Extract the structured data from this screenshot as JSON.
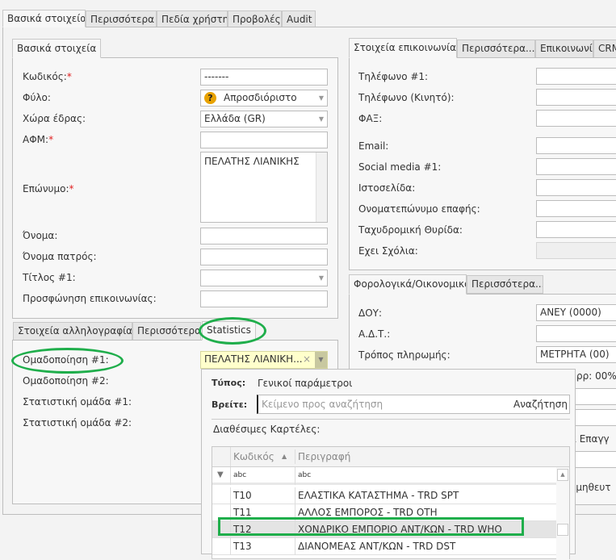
{
  "main_tabs": [
    "Βασικά στοιχεία",
    "Περισσότερα",
    "Πεδία χρήστη",
    "Προβολές",
    "Audit"
  ],
  "basic": {
    "tab": "Βασικά στοιχεία",
    "fields": [
      {
        "label": "Κωδικός:",
        "required": true,
        "value": "-------"
      },
      {
        "label": "Φύλο:",
        "value": "Απροσδιόριστο"
      },
      {
        "label": "Χώρα έδρας:",
        "value": "Ελλάδα (GR)"
      },
      {
        "label": "ΑΦΜ:",
        "required": true,
        "value": ""
      },
      {
        "label": "Επώνυμο:",
        "required": true,
        "value": "ΠΕΛΑΤΗΣ ΛΙΑΝΙΚΗΣ"
      },
      {
        "label": "Όνομα:",
        "value": ""
      },
      {
        "label": "Όνομα πατρός:",
        "value": ""
      },
      {
        "label": "Τίτλος #1:",
        "value": ""
      },
      {
        "label": "Προσφώνηση επικοινωνίας:",
        "value": ""
      }
    ]
  },
  "lower_left": {
    "tabs": [
      "Στοιχεία αλληλογραφίας",
      "Περισσότερα",
      "Statistics"
    ],
    "fields": [
      "Ομαδοποίηση #1:",
      "Ομαδοποίηση #2:",
      "Στατιστική ομάδα #1:",
      "Στατιστική ομάδα #2:"
    ],
    "group1_value": "ΠΕΛΑΤΗΣ ΛΙΑΝΙΚΗ...",
    "clear": "×"
  },
  "popup": {
    "type_label": "Τύπος:",
    "type_value": "Γενικοί παράμετροι",
    "find_label": "Βρείτε:",
    "search_placeholder": "Κείμενο προς αναζήτηση",
    "search_button": "Αναζήτηση",
    "available_label": "Διαθέσιμες Καρτέλες:",
    "columns": [
      "Κωδικός",
      "Περιγραφή"
    ],
    "filter": [
      "abc",
      "abc"
    ],
    "rows": [
      {
        "code": "T10",
        "desc": "ΕΛΑΣΤΙΚΑ ΚΑΤΑΣΤΗΜΑ - TRD SPT"
      },
      {
        "code": "T11",
        "desc": "ΑΛΛΟΣ ΕΜΠΟΡΟΣ - TRD OTH"
      },
      {
        "code": "T12",
        "desc": "ΧΟΝΔΡΙΚΟ ΕΜΠΟΡΙΟ ΑΝΤ/ΚΩΝ  - TRD WHO"
      },
      {
        "code": "T13",
        "desc": "ΔΙΑΝΟΜΕΑΣ ΑΝΤ/ΚΩΝ - TRD DST"
      }
    ]
  },
  "contact": {
    "tabs": [
      "Στοιχεία επικοινωνίας",
      "Περισσότερα...",
      "Επικοινωνία",
      "CRM"
    ],
    "fields": [
      "Τηλέφωνο #1:",
      "Τηλέφωνο (Κινητό):",
      "ΦΑΞ:",
      "Email:",
      "Social media #1:",
      "Ιστοσελίδα:",
      "Ονοματεπώνυμο επαφής:",
      "Ταχυδρομική Θυρίδα:",
      "Εχει Σχόλια:"
    ]
  },
  "tax": {
    "tabs": [
      "Φορολογικά/Οικονομικά",
      "Περισσότερα..."
    ],
    "fields": [
      {
        "label": "ΔΟΥ:",
        "value": "ΑΝΕΥ (0000)"
      },
      {
        "label": "Α.Δ.Τ.:",
        "value": ""
      },
      {
        "label": "Τρόπος πληρωμής:",
        "value": "ΜΕΤΡΗΤΑ (00)"
      }
    ],
    "partial": [
      "ρρ: 00%",
      "α Επαγγ",
      "ομηθευτ"
    ]
  },
  "colors": {
    "highlight": "#1fae4b",
    "combo_bg": "#ffffcc",
    "warn_icon": "#e8a200"
  }
}
